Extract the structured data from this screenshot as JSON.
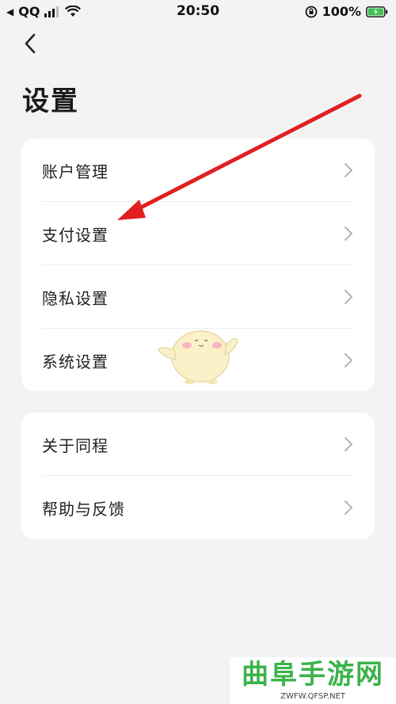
{
  "status_bar": {
    "back_app": "QQ",
    "time": "20:50",
    "battery": "100%"
  },
  "header": {
    "title": "设置"
  },
  "settings_group_1": [
    {
      "label": "账户管理"
    },
    {
      "label": "支付设置"
    },
    {
      "label": "隐私设置"
    },
    {
      "label": "系统设置"
    }
  ],
  "settings_group_2": [
    {
      "label": "关于同程"
    },
    {
      "label": "帮助与反馈"
    }
  ],
  "watermark": {
    "title": "曲阜手游网",
    "url": "ZWFW.QFSP.NET"
  },
  "colors": {
    "annotation_arrow": "#e02020",
    "watermark_green": "#3bb34a"
  },
  "icons": [
    "back-chevron-icon",
    "chevron-right-icon",
    "signal-icon",
    "wifi-icon",
    "battery-icon",
    "rotation-lock-icon"
  ]
}
